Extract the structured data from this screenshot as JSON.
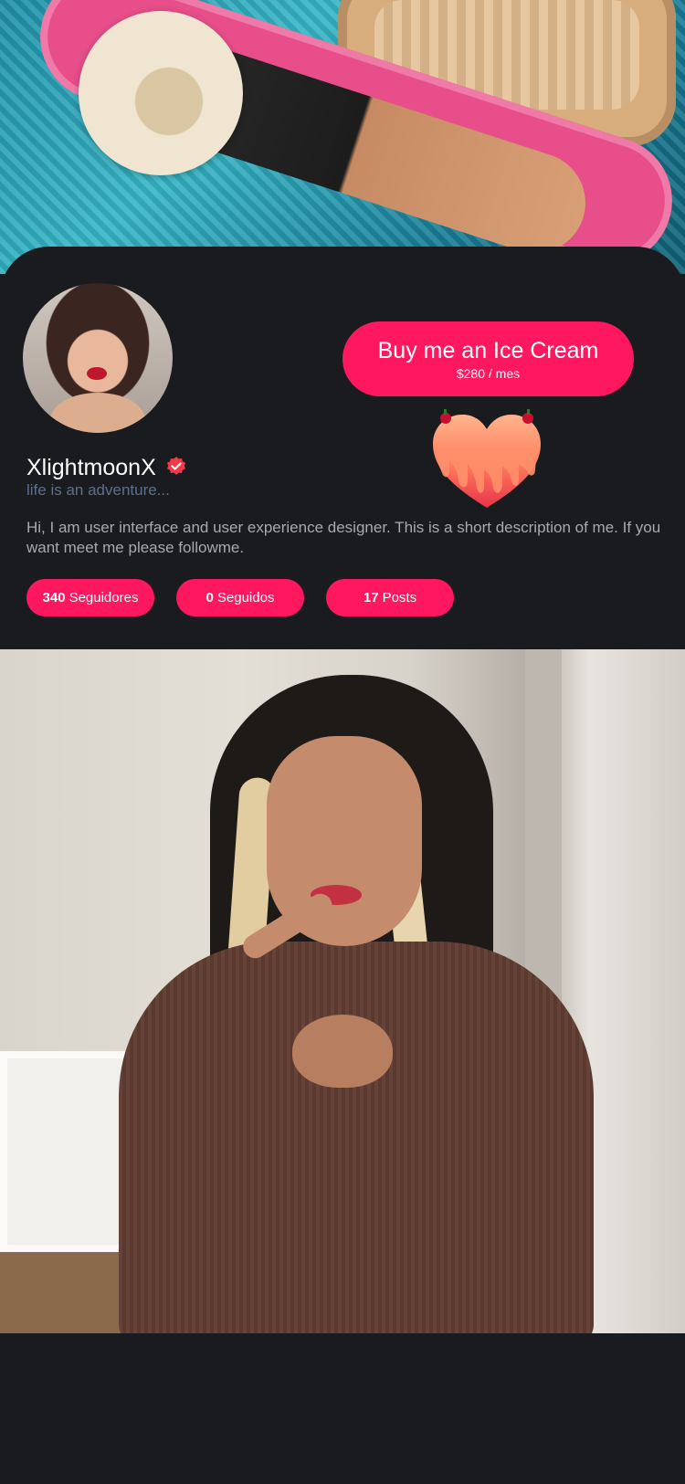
{
  "cover": {
    "image": "pool-scene-cover-photo"
  },
  "profile": {
    "avatar": "profile-avatar-photo",
    "username": "XlightmoonX",
    "verified_icon": "verified-check-icon",
    "tagline": "life is an adventure...",
    "bio": "Hi, I am user interface and user experience designer. This is a short description of me. If you want meet me please followme."
  },
  "support": {
    "button_label": "Buy me an Ice Cream",
    "price": "$280 / mes",
    "illustration": "dripping-heart-icon"
  },
  "stats": [
    {
      "count": "340",
      "label": "Seguidores"
    },
    {
      "count": "0",
      "label": "Seguidos"
    },
    {
      "count": "17",
      "label": "Posts"
    }
  ],
  "post": {
    "image": "profile-post-photo"
  },
  "colors": {
    "background": "#1a1b1f",
    "accent": "#ff1760",
    "text_primary": "#ffffff",
    "text_secondary": "#a7a9b0",
    "tagline": "#5c6f8f"
  }
}
